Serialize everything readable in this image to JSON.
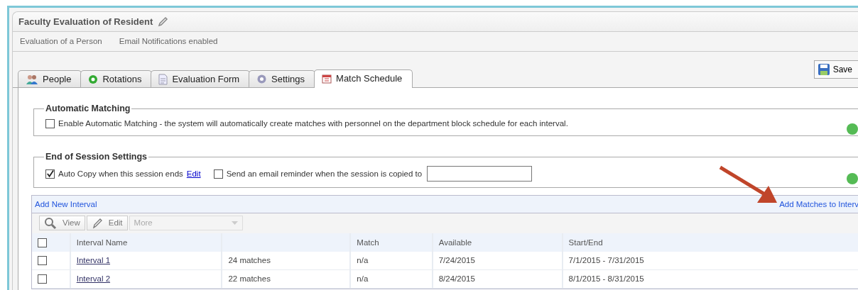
{
  "header": {
    "title": "Faculty Evaluation of Resident",
    "details": [
      "Evaluation of a Person",
      "Email Notifications enabled"
    ]
  },
  "tabs": [
    {
      "label": "People",
      "selected": false
    },
    {
      "label": "Rotations",
      "selected": false
    },
    {
      "label": "Evaluation Form",
      "selected": false
    },
    {
      "label": "Settings",
      "selected": false
    },
    {
      "label": "Match Schedule",
      "selected": true
    }
  ],
  "save_button": "Save",
  "automatic_matching": {
    "legend": "Automatic Matching",
    "option": {
      "label": "Enable Automatic Matching - the system will automatically create matches with personnel on the department block schedule for each interval.",
      "checked": false
    }
  },
  "end_of_session": {
    "legend": "End of Session Settings",
    "auto_copy": {
      "label": "Auto Copy when this session ends",
      "checked": true
    },
    "edit_link": "Edit",
    "reminder": {
      "label": "Send an email reminder when the session is copied to",
      "checked": false
    }
  },
  "intervals": {
    "add_link": "Add New Interval",
    "add_matches_link": "Add Matches to Interv",
    "toolbar": {
      "view": "View",
      "edit": "Edit",
      "more": "More"
    },
    "header_checked": false,
    "columns": [
      "Interval Name",
      "",
      "Match",
      "Available",
      "Start/End"
    ],
    "rows": [
      {
        "selected": false,
        "cells": [
          "Interval 1",
          "24 matches",
          "n/a",
          "7/24/2015",
          "7/1/2015 - 7/31/2015"
        ]
      },
      {
        "selected": false,
        "cells": [
          "Interval 2",
          "22 matches",
          "n/a",
          "8/24/2015",
          "8/1/2015 - 8/31/2015"
        ]
      }
    ]
  }
}
